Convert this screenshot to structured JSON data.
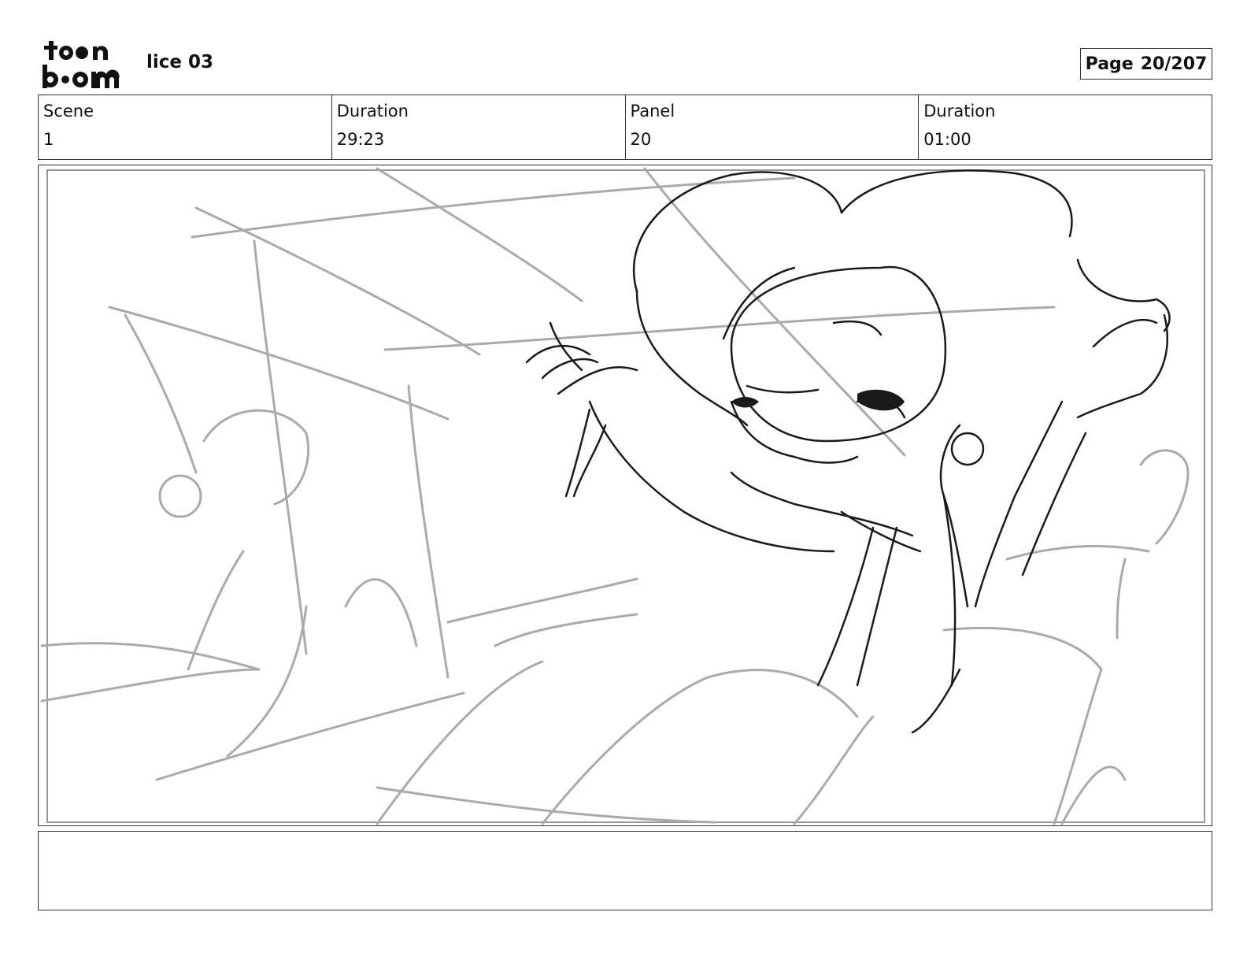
{
  "header": {
    "logo_alt": "toon boom",
    "title": "lice 03",
    "page_label": "Page",
    "page_value": "20/207"
  },
  "info": [
    {
      "label": "Scene",
      "value": "1"
    },
    {
      "label": "Duration",
      "value": "29:23"
    },
    {
      "label": "Panel",
      "value": "20"
    },
    {
      "label": "Duration",
      "value": "01:00"
    }
  ],
  "panel": {
    "image_icon": "storyboard-sketch-image"
  },
  "notes": {
    "text": ""
  }
}
